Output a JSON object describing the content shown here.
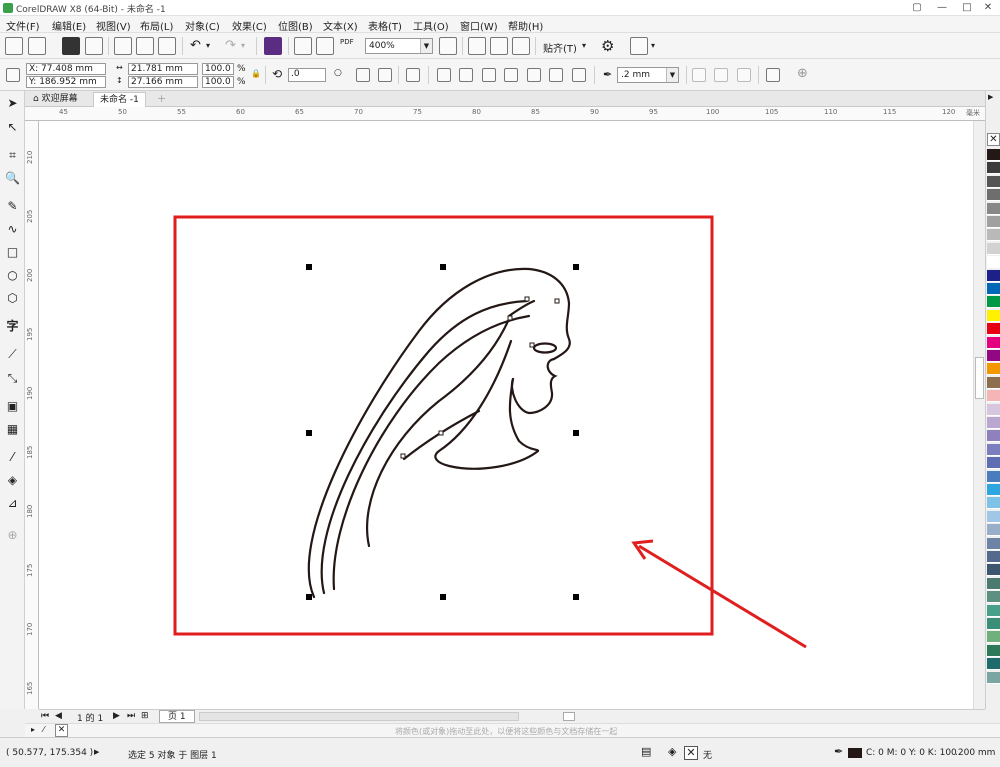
{
  "window": {
    "title": "CorelDRAW X8 (64-Bit) - 未命名 -1",
    "controls": [
      "restore-icon",
      "minimize-icon",
      "maximize-icon",
      "close-icon"
    ]
  },
  "menu": [
    "文件(F)",
    "编辑(E)",
    "视图(V)",
    "布局(L)",
    "对象(C)",
    "效果(C)",
    "位图(B)",
    "文本(X)",
    "表格(T)",
    "工具(O)",
    "窗口(W)",
    "帮助(H)"
  ],
  "toolbar1": {
    "zoom": "400%",
    "snap_label": "贴齐(T)",
    "pdf_label": "PDF"
  },
  "propertybar": {
    "x": "X: 77.408 mm",
    "y": "Y: 186.952 mm",
    "width": "21.781 mm",
    "height": "27.166 mm",
    "scale_w": "100.0",
    "scale_h": "100.0",
    "pct": "%",
    "rotation": ".0",
    "outline_width": ".2 mm"
  },
  "tabs": {
    "welcome": "欢迎屏幕",
    "document": "未命名 -1"
  },
  "ruler": {
    "h_ticks": [
      "45",
      "50",
      "55",
      "60",
      "65",
      "70",
      "75",
      "80",
      "85",
      "90",
      "95",
      "100",
      "105",
      "110",
      "115",
      "120"
    ],
    "h_unit": "毫米",
    "v_ticks": [
      "210",
      "205",
      "200",
      "195",
      "190",
      "185",
      "180",
      "175",
      "170",
      "165"
    ]
  },
  "pagebar": {
    "page_count": "1 的 1",
    "page_tab": "页 1"
  },
  "docpalette_hint": "将颜色(或对象)拖动至此处，以便将这些颜色与文档存储在一起",
  "status": {
    "coords": "( 50.577, 175.354 )",
    "selection": "选定 5 对象 于 图层 1",
    "fill_none": "无",
    "outline_color": "C: 0 M: 0 Y: 0 K: 100",
    "outline_width": ".200 mm"
  },
  "colors": {
    "highlight_red": "#e01e1e",
    "palette": [
      "#231815",
      "#3c3c3c",
      "#555555",
      "#6e6e6e",
      "#888888",
      "#a0a0a0",
      "#b9b9b9",
      "#d2d2d2",
      "#ffffff",
      "#1d2088",
      "#0068b7",
      "#009944",
      "#fff100",
      "#e60012",
      "#e4007f",
      "#920783",
      "#f39800",
      "#8f6e4f",
      "#f5b4b5",
      "#d6c7df",
      "#b9a7d0",
      "#8f82bc",
      "#7b7fc0",
      "#5e6db4",
      "#4a7dbd",
      "#2ea7e0",
      "#7fc2e8",
      "#a0c8e6",
      "#98aec9",
      "#6d84a6",
      "#546a8c",
      "#3e5570",
      "#4c7a70",
      "#5e9082",
      "#46a08a",
      "#3b8e77",
      "#6fb07d",
      "#2c7a5a",
      "#1d6b6b",
      "#7aa5a0"
    ]
  }
}
